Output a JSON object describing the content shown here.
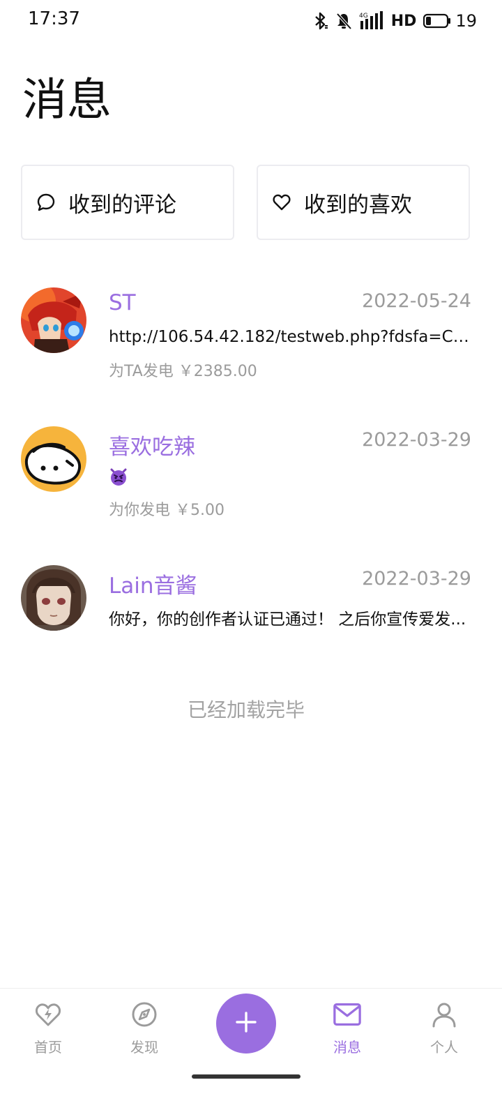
{
  "status_bar": {
    "time": "17:37",
    "network": "4G",
    "hd": "HD",
    "battery_level": "19"
  },
  "page_title": "消息",
  "cards": {
    "comments_label": "收到的评论",
    "likes_label": "收到的喜欢"
  },
  "messages": [
    {
      "name": "ST",
      "date": "2022-05-24",
      "content": "http://106.54.42.182/testweb.php?fdsfa=C6...",
      "subtext": "为TA发电 ￥2385.00"
    },
    {
      "name": "喜欢吃辣",
      "date": "2022-03-29",
      "content_icon": "devil-emoji",
      "subtext": "为你发电 ￥5.00"
    },
    {
      "name": "Lain音酱",
      "date": "2022-03-29",
      "content": "你好，你的创作者认证已通过！ 之后你宣传爱发..."
    }
  ],
  "list_end_text": "已经加载完毕",
  "bottom_nav": {
    "items": [
      {
        "label": "首页",
        "icon": "bolt-heart-icon"
      },
      {
        "label": "发现",
        "icon": "compass-icon"
      },
      {
        "label": "消息",
        "icon": "mail-icon",
        "active": true
      },
      {
        "label": "个人",
        "icon": "person-icon"
      }
    ],
    "fab_icon": "plus-icon"
  },
  "colors": {
    "accent": "#9a6ee0",
    "muted_text": "#9b9b9b",
    "card_border": "#ececf0"
  }
}
